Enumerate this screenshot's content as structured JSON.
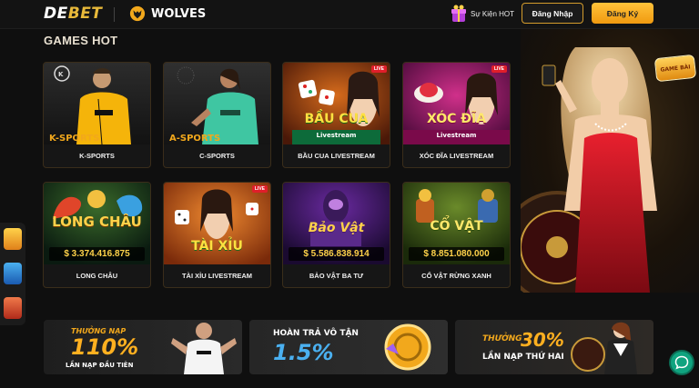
{
  "header": {
    "logo_main": "DE",
    "logo_accent": "BET",
    "partner": "WOLVES",
    "event": "Sự Kiện HOT",
    "login": "Đăng Nhập",
    "register": "Đăng Ký"
  },
  "section": {
    "title": "GAMES HOT"
  },
  "games": [
    {
      "name": "K-SPORTS",
      "art": "K-SPORTS"
    },
    {
      "name": "C-SPORTS",
      "art": "A-SPORTS"
    },
    {
      "name": "BẦU CUA LIVESTREAM",
      "art": "BẦU CUA",
      "sub": "Livestream",
      "live": "LIVE"
    },
    {
      "name": "XÓC ĐĨA LIVESTREAM",
      "art": "XÓC ĐĨA",
      "sub": "Livestream",
      "live": "LIVE"
    },
    {
      "name": "LONG CHÂU",
      "art": "LONG CHÂU",
      "jackpot": "$ 3.374.416.875"
    },
    {
      "name": "TÀI XỈU LIVESTREAM",
      "art": "TÀI XỈU",
      "live": "LIVE"
    },
    {
      "name": "BẢO VẬT BA TƯ",
      "art": "Bảo Vật",
      "jackpot": "$ 5.586.838.914"
    },
    {
      "name": "CỔ VẬT RỪNG XANH",
      "art": "CỔ VẬT",
      "jackpot": "$ 8.851.080.000"
    }
  ],
  "hero": {
    "badge": "GAME BÀI"
  },
  "promos": [
    {
      "line1": "THƯỞNG NẠP",
      "big": "110%",
      "line2": "LẦN NẠP ĐẦU TIÊN"
    },
    {
      "line1": "HOÀN TRẢ VÔ TẬN",
      "big": "1.5%"
    },
    {
      "line1": "THƯỞNG",
      "big": "30%",
      "line2": "LẦN NẠP THỨ HAI"
    }
  ],
  "colors": {
    "gold": "#f2a81c",
    "live_red": "#e01e2a",
    "chat_green": "#10a37f"
  }
}
